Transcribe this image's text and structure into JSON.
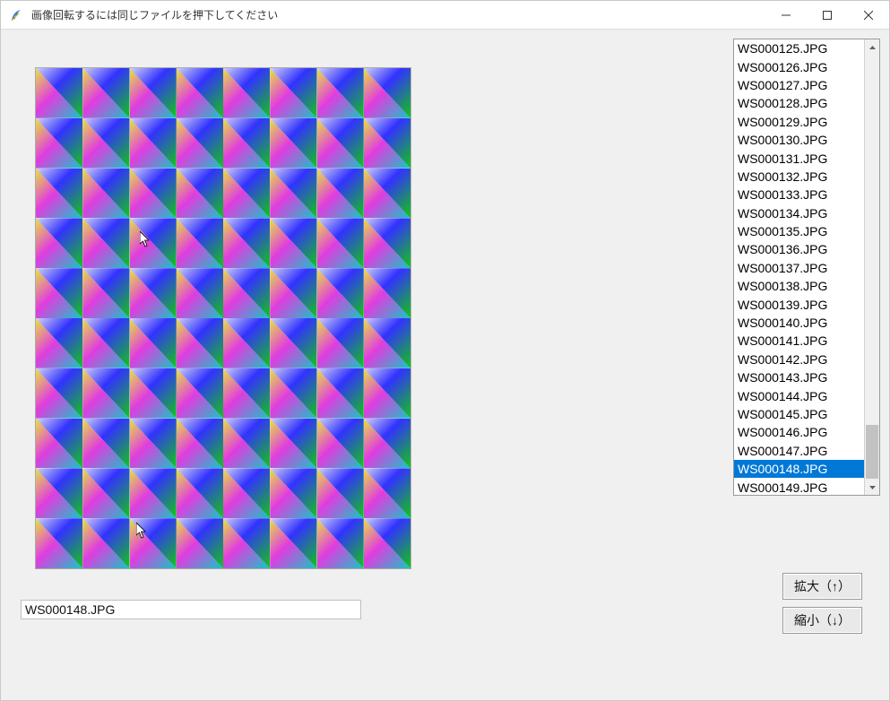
{
  "window": {
    "title": "画像回転するには同じファイルを押下してください"
  },
  "filename_field": {
    "value": "WS000148.JPG"
  },
  "file_list": {
    "items": [
      "WS000125.JPG",
      "WS000126.JPG",
      "WS000127.JPG",
      "WS000128.JPG",
      "WS000129.JPG",
      "WS000130.JPG",
      "WS000131.JPG",
      "WS000132.JPG",
      "WS000133.JPG",
      "WS000134.JPG",
      "WS000135.JPG",
      "WS000136.JPG",
      "WS000137.JPG",
      "WS000138.JPG",
      "WS000139.JPG",
      "WS000140.JPG",
      "WS000141.JPG",
      "WS000142.JPG",
      "WS000143.JPG",
      "WS000144.JPG",
      "WS000145.JPG",
      "WS000146.JPG",
      "WS000147.JPG",
      "WS000148.JPG",
      "WS000149.JPG"
    ],
    "selected_index": 23
  },
  "buttons": {
    "zoom_in": "拡大（↑）",
    "zoom_out": "縮小（↓）"
  },
  "icons": {
    "app": "feather-icon",
    "minimize": "minimize-icon",
    "maximize": "maximize-icon",
    "close": "close-icon",
    "scroll_up": "chevron-up-icon",
    "scroll_down": "chevron-down-icon"
  }
}
